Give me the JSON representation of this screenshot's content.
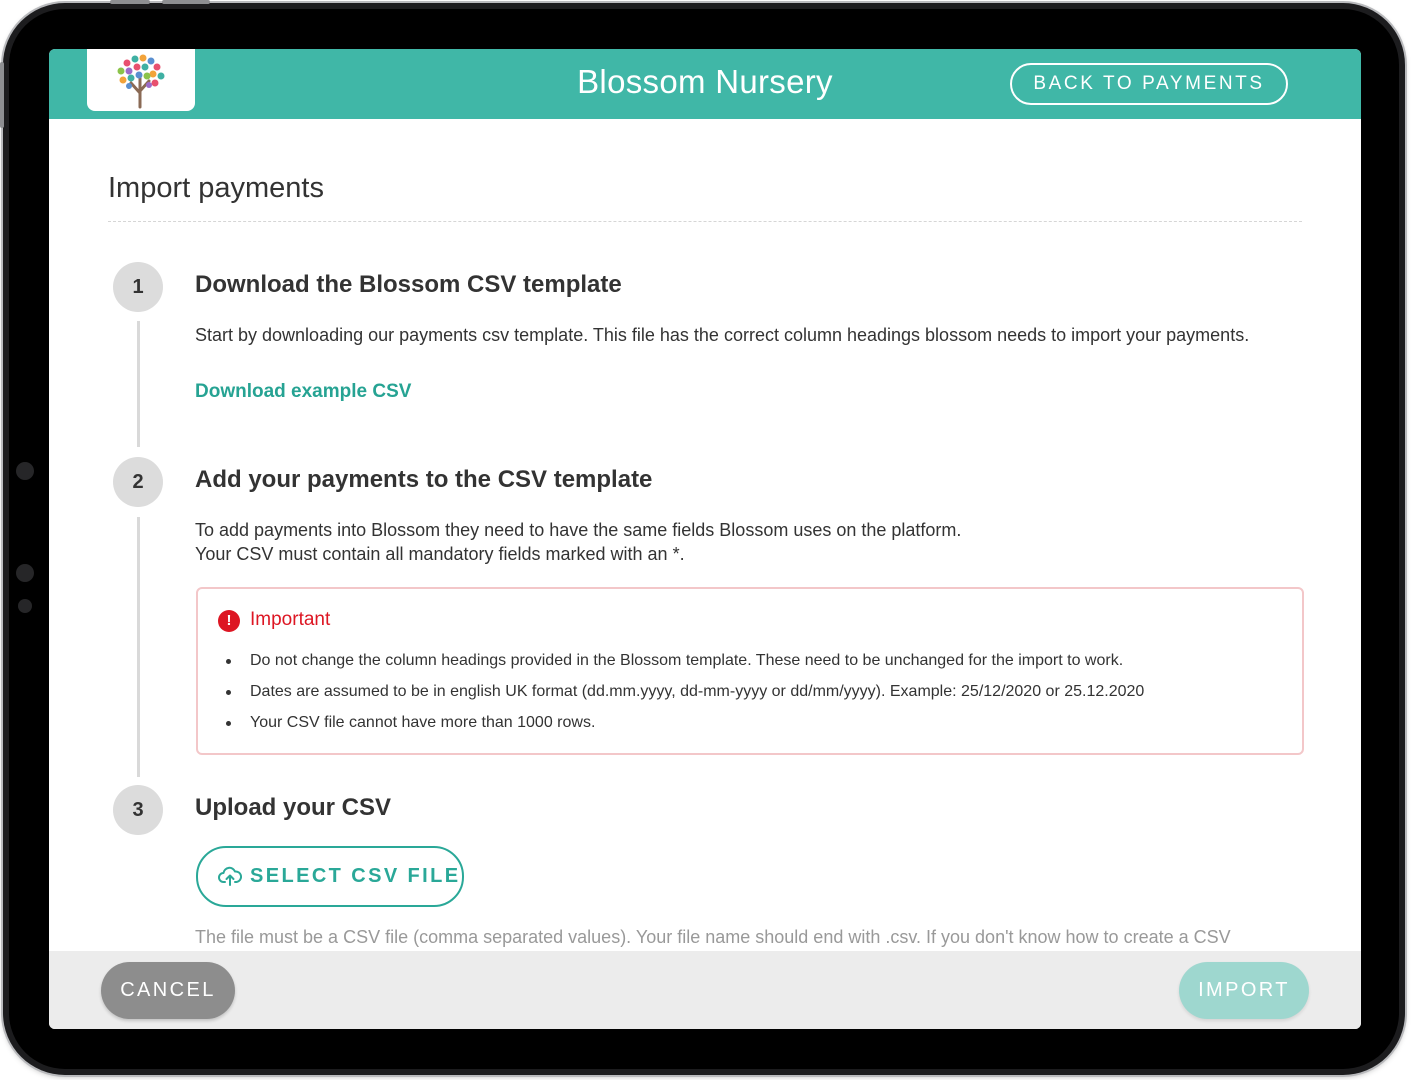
{
  "header": {
    "title": "Blossom Nursery",
    "back_label": "BACK TO PAYMENTS",
    "logo": "tree-logo"
  },
  "page": {
    "title": "Import payments"
  },
  "steps": [
    {
      "number": "1",
      "title": "Download the Blossom CSV template",
      "text": "Start by downloading our payments csv template. This file has the correct column headings blossom needs to import your payments.",
      "link": "Download example CSV"
    },
    {
      "number": "2",
      "title": "Add your payments to the CSV template",
      "text_line1": "To add payments into Blossom they need to have the same fields Blossom uses on the platform.",
      "text_line2": "Your CSV must contain all mandatory fields marked with an *."
    },
    {
      "number": "3",
      "title": "Upload your CSV",
      "button": "SELECT CSV FILE",
      "hint": "The file must be a CSV file (comma separated values). Your file name should end with .csv. If you don't know how to create a CSV"
    }
  ],
  "important": {
    "title": "Important",
    "icon": "alert-icon",
    "items": [
      "Do not change the column headings provided in the Blossom template. These need to be unchanged for the import to work.",
      "Dates are assumed to be in english UK format (dd.mm.yyyy, dd-mm-yyyy or dd/mm/yyyy). Example: 25/12/2020 or 25.12.2020",
      "Your CSV file cannot have more than 1000 rows."
    ]
  },
  "footer": {
    "cancel_label": "CANCEL",
    "import_label": "IMPORT"
  },
  "colors": {
    "brand": "#40b7a7",
    "accent": "#26a393",
    "alert": "#dd1623"
  }
}
